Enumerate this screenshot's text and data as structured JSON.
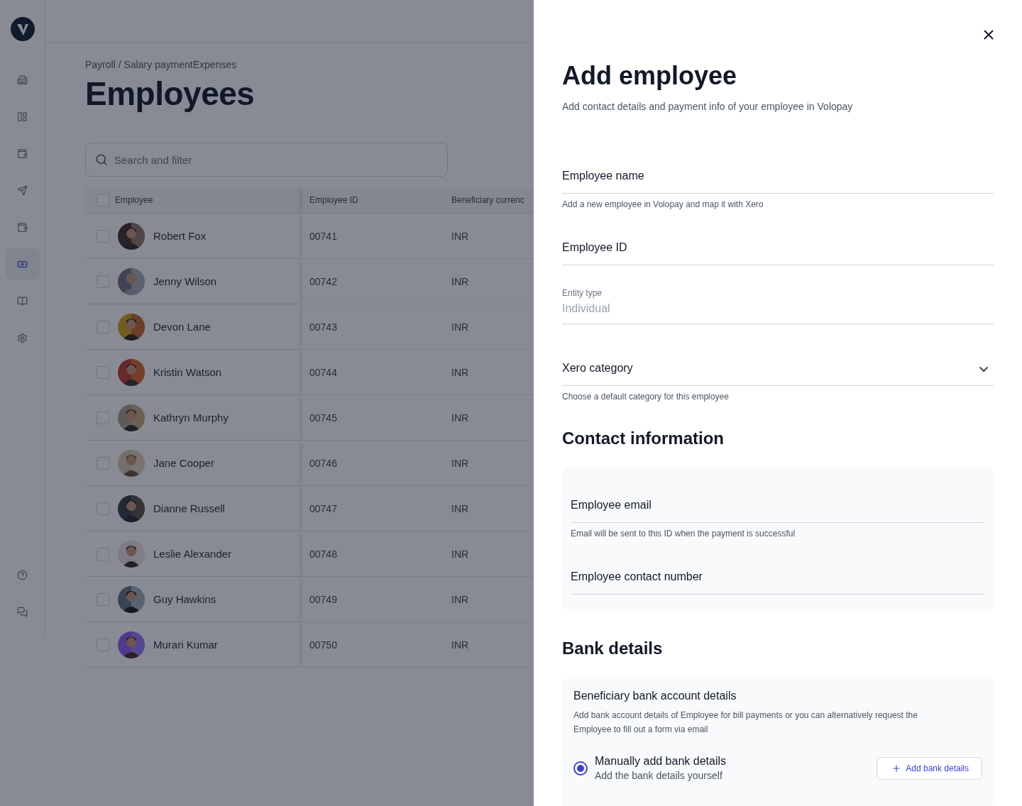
{
  "sidebar": {
    "items": [
      {
        "selected": false
      },
      {
        "selected": false
      },
      {
        "selected": false
      },
      {
        "selected": false
      },
      {
        "selected": false
      },
      {
        "selected": true
      },
      {
        "selected": false
      },
      {
        "selected": false
      }
    ],
    "bottom_items": [
      {
        "selected": false
      },
      {
        "selected": false
      }
    ]
  },
  "breadcrumb": "Payroll / Salary paymentExpenses",
  "page_title": "Employees",
  "search": {
    "placeholder": "Search and filter"
  },
  "table": {
    "header_checked": false,
    "columns": [
      "Employee",
      "Employee ID",
      "Beneficiary currenc"
    ],
    "rows": [
      {
        "name": "Robert Fox",
        "id": "00741",
        "currency": "INR",
        "checked": false
      },
      {
        "name": "Jenny Wilson",
        "id": "00742",
        "currency": "INR",
        "checked": false
      },
      {
        "name": "Devon Lane",
        "id": "00743",
        "currency": "INR",
        "checked": false
      },
      {
        "name": "Kristin Watson",
        "id": "00744",
        "currency": "INR",
        "checked": false
      },
      {
        "name": "Kathryn Murphy",
        "id": "00745",
        "currency": "INR",
        "checked": false
      },
      {
        "name": "Jane Cooper",
        "id": "00746",
        "currency": "INR",
        "checked": false
      },
      {
        "name": "Dianne Russell",
        "id": "00747",
        "currency": "INR",
        "checked": false
      },
      {
        "name": "Leslie Alexander",
        "id": "00748",
        "currency": "INR",
        "checked": false
      },
      {
        "name": "Guy Hawkins",
        "id": "00749",
        "currency": "INR",
        "checked": false
      },
      {
        "name": "Murari Kumar",
        "id": "00750",
        "currency": "INR",
        "checked": false
      }
    ]
  },
  "drawer": {
    "title": "Add employee",
    "subtitle": "Add contact details and payment info of your employee in Volopay",
    "fields": [
      {
        "kind": "text",
        "placeholder": "Employee name",
        "helper": "Add a new employee in Volopay and map it with Xero"
      },
      {
        "kind": "text",
        "placeholder": "Employee ID"
      },
      {
        "kind": "readonly",
        "label": "Entity type",
        "value": "Individual",
        "disabled": true
      },
      {
        "kind": "select",
        "placeholder": "Xero category",
        "helper": "Choose a default category for this employee"
      }
    ],
    "contact": {
      "title": "Contact information",
      "fields": [
        {
          "kind": "text",
          "placeholder": "Employee email",
          "helper": "Email will be sent to this ID when the payment is successful"
        },
        {
          "kind": "text",
          "placeholder": "Employee contact number"
        }
      ]
    },
    "bank": {
      "title": "Bank details",
      "card_title": "Beneficiary bank account details",
      "card_description": "Add bank account details of Employee for bill payments or you can alternatively request the Employee to fill out a form via email",
      "options": [
        {
          "label": "Manually add bank details",
          "description": "Add the bank details yourself",
          "selected": true,
          "button": "Add bank details"
        }
      ]
    }
  }
}
